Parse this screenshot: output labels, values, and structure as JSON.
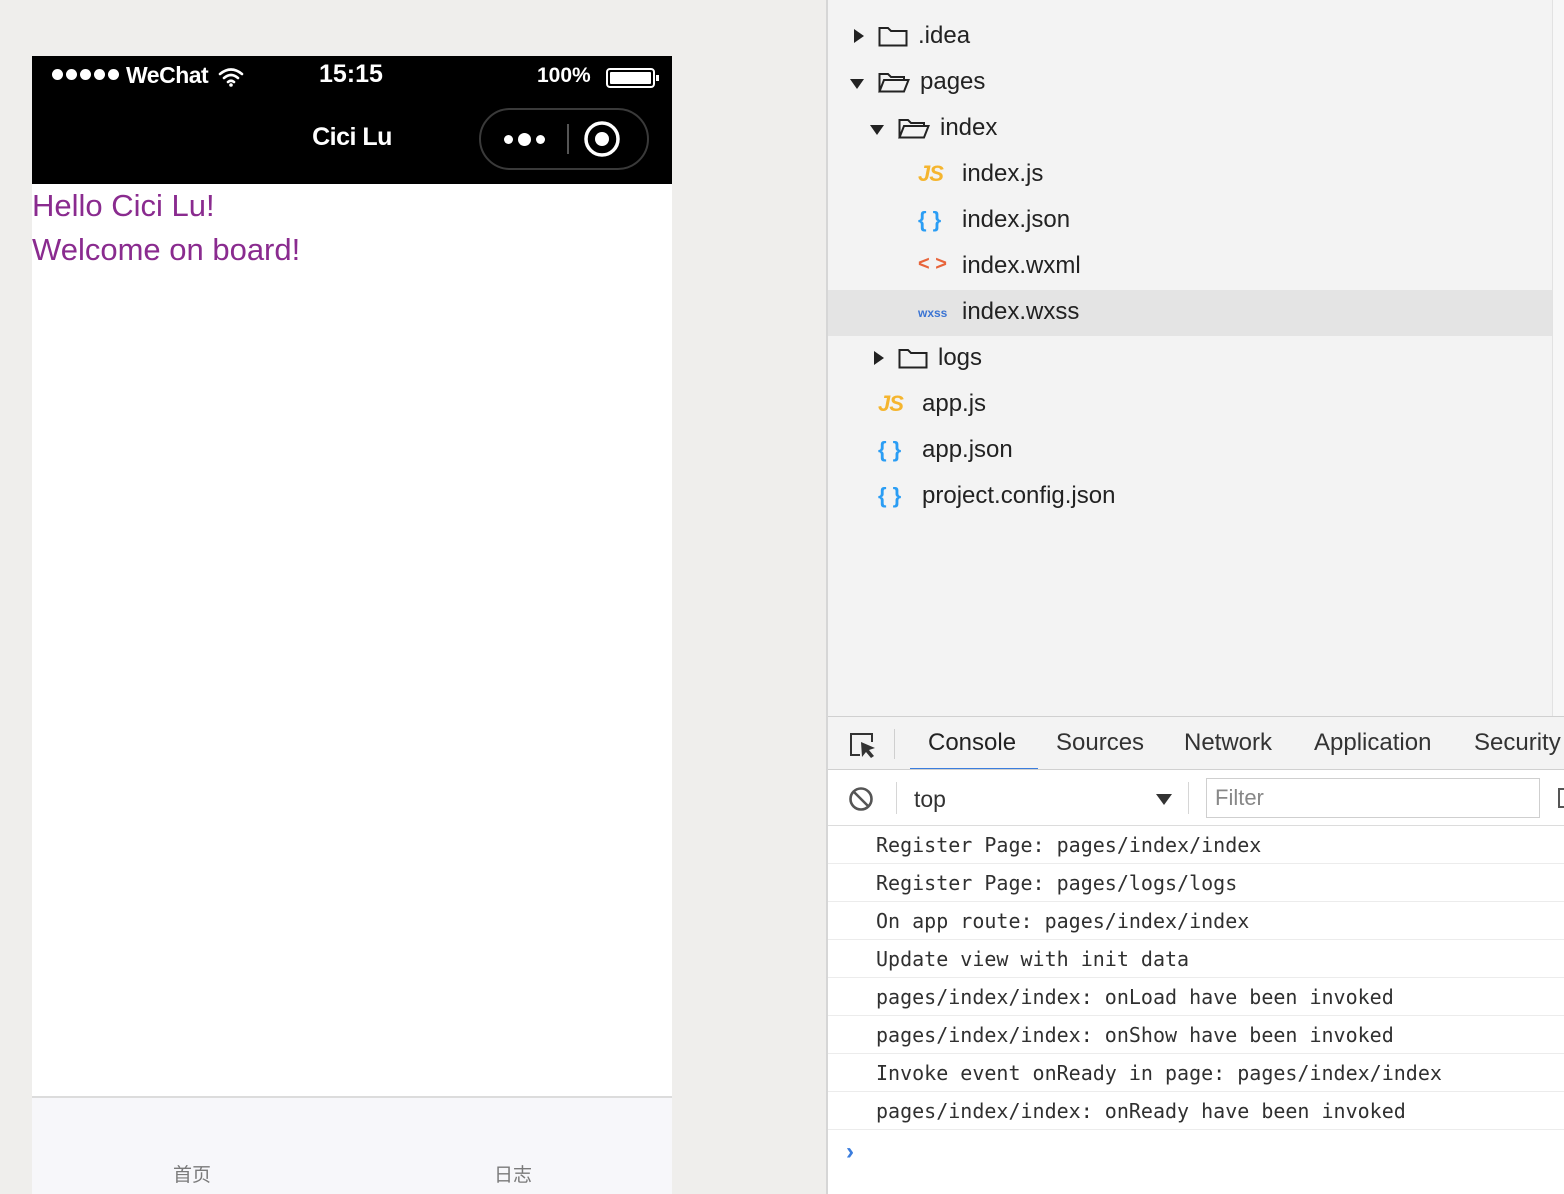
{
  "simulator": {
    "status_bar": {
      "carrier": "WeChat",
      "time": "15:15",
      "battery": "100%"
    },
    "nav_bar": {
      "title": "Cici Lu"
    },
    "content": {
      "line1": "Hello Cici Lu!",
      "line2": "Welcome on board!"
    },
    "tab_bar": {
      "tabs": [
        {
          "label": "首页"
        },
        {
          "label": "日志"
        }
      ]
    }
  },
  "file_tree": {
    "items": [
      {
        "label": ".idea",
        "type": "folder",
        "expanded": false
      },
      {
        "label": "pages",
        "type": "folder",
        "expanded": true
      },
      {
        "label": "index",
        "type": "folder",
        "expanded": true
      },
      {
        "label": "index.js",
        "type": "js",
        "icon": "JS"
      },
      {
        "label": "index.json",
        "type": "json",
        "icon": "{ }"
      },
      {
        "label": "index.wxml",
        "type": "wxml",
        "icon": "< >"
      },
      {
        "label": "index.wxss",
        "type": "wxss",
        "icon": "wxss",
        "selected": true
      },
      {
        "label": "logs",
        "type": "folder",
        "expanded": false
      },
      {
        "label": "app.js",
        "type": "js",
        "icon": "JS"
      },
      {
        "label": "app.json",
        "type": "json",
        "icon": "{ }"
      },
      {
        "label": "project.config.json",
        "type": "json",
        "icon": "{ }"
      }
    ]
  },
  "devtools": {
    "tabs": [
      {
        "label": "Console",
        "active": true
      },
      {
        "label": "Sources"
      },
      {
        "label": "Network"
      },
      {
        "label": "Application"
      },
      {
        "label": "Security"
      }
    ],
    "toolbar": {
      "context": "top",
      "filter_placeholder": "Filter"
    },
    "console_lines": [
      "Register Page: pages/index/index",
      "Register Page: pages/logs/logs",
      "On app route: pages/index/index",
      "Update view with init data",
      "pages/index/index: onLoad have been invoked",
      "pages/index/index: onShow have been invoked",
      "Invoke event onReady in page: pages/index/index",
      "pages/index/index: onReady have been invoked"
    ],
    "prompt": "›"
  },
  "colors": {
    "greeting_text": "#8a2b8f",
    "accent": "#3b7ddd",
    "js_icon": "#f5b52e",
    "json_icon": "#2a9df4",
    "wxml_icon": "#e8643a",
    "wxss_icon": "#3b74d3"
  }
}
